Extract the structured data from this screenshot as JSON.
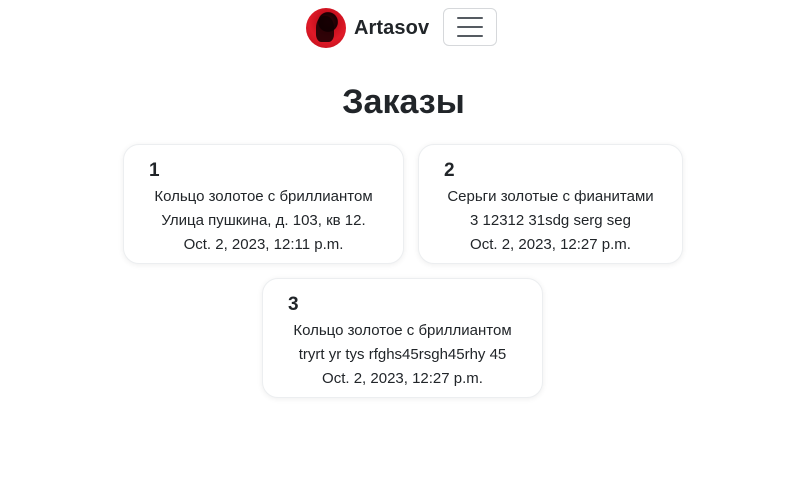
{
  "navbar": {
    "brand_name": "Artasov",
    "avatar_icon": "user-avatar-icon",
    "menu_icon": "hamburger-menu-icon"
  },
  "page": {
    "title": "Заказы"
  },
  "orders": [
    {
      "number": "1",
      "product": "Кольцо золотое с бриллиантом",
      "address": "Улица пушкина, д. 103, кв 12.",
      "date": "Oct. 2, 2023, 12:11 p.m."
    },
    {
      "number": "2",
      "product": "Серьги золотые с фианитами",
      "address": "3 12312 31sdg serg seg",
      "date": "Oct. 2, 2023, 12:27 p.m."
    },
    {
      "number": "3",
      "product": "Кольцо золотое с бриллиантом",
      "address": "tryrt yr tys rfghs45rsgh45rhy 45",
      "date": "Oct. 2, 2023, 12:27 p.m."
    }
  ]
}
